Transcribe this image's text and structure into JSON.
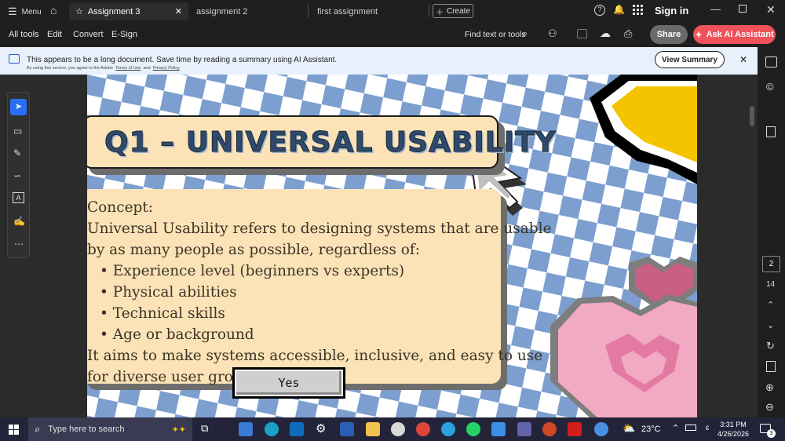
{
  "titlebar": {
    "menu_label": "Menu",
    "tabs": [
      {
        "label": "Assignment 3"
      },
      {
        "label": "assignment 2"
      },
      {
        "label": "first assignment"
      }
    ],
    "create_label": "Create",
    "sign_in_label": "Sign in"
  },
  "toolbar": {
    "items": [
      "All tools",
      "Edit",
      "Convert",
      "E-Sign"
    ],
    "find_label": "Find text or tools",
    "share_label": "Share",
    "ai_label": "Ask AI Assistant"
  },
  "banner": {
    "message": "This appears to be a long document. Save time by reading a summary using AI Assistant.",
    "fine_print_prefix": "By using this service, you agree to the Adobe",
    "terms_label": "Terms of Use",
    "and_label": "and",
    "privacy_label": "Privacy Policy",
    "view_summary_label": "View Summary"
  },
  "slide": {
    "title": "Q1 – UNIVERSAL USABILITY",
    "concept_label": "Concept:",
    "body_line1": "Universal Usability refers to designing systems that are usable",
    "body_line2": "by as many people as possible, regardless of:",
    "bullets": [
      "Experience level (beginners vs experts)",
      "Physical abilities",
      "Technical skills",
      "Age or background"
    ],
    "closing_line1": "It aims to make systems accessible, inclusive, and easy to use",
    "closing_line2": "for diverse user groups",
    "yes_button": "Yes",
    "colors": {
      "card": "#fbe3b7",
      "title": "#2f4a6b",
      "checker": "#8aaad2",
      "heart": "#f2a9c2"
    }
  },
  "right_rail": {
    "current_page": "2",
    "total_pages": "14"
  },
  "taskbar": {
    "search_placeholder": "Type here to search",
    "weather": "23°C",
    "time": "3:31 PM",
    "date": "4/26/2026",
    "notification_count": "3"
  }
}
